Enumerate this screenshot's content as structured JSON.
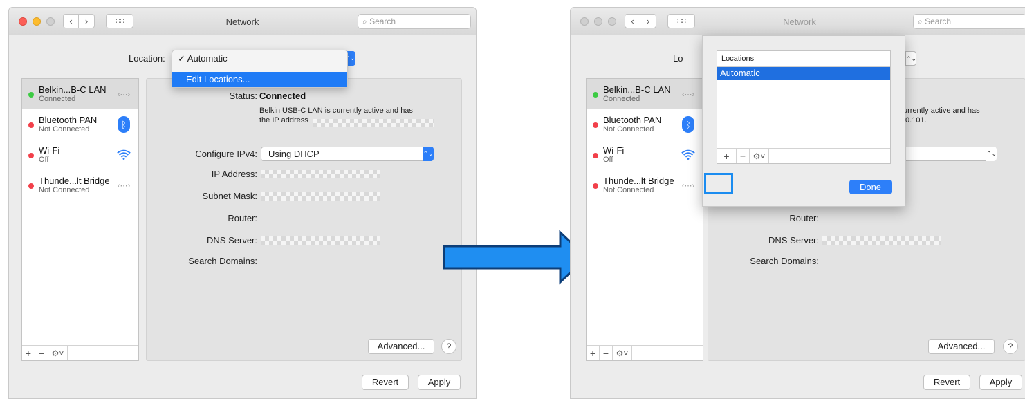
{
  "window_title": "Network",
  "search_placeholder": "Search",
  "location_label": "Location:",
  "location_label_truncated": "Lo",
  "location_menu": {
    "checked": "✓ Automatic",
    "edit": "Edit Locations..."
  },
  "services": [
    {
      "name": "Belkin...B-C LAN",
      "status": "Connected",
      "color": "#3ccb43"
    },
    {
      "name": "Bluetooth PAN",
      "status": "Not Connected",
      "color": "#f2404a"
    },
    {
      "name": "Wi-Fi",
      "status": "Off",
      "color": "#f2404a"
    },
    {
      "name": "Thunde...lt Bridge",
      "status": "Not Connected",
      "color": "#f2404a"
    }
  ],
  "detail": {
    "status_label": "Status:",
    "status_value": "Connected",
    "status_desc_line1": "Belkin USB-C LAN is currently active and has",
    "status_desc_line2": "the IP address",
    "status_desc_line1_partial": "urrently active and has",
    "status_desc_line2_partial": ".0.101.",
    "configure_label": "Configure IPv4:",
    "configure_value": "Using DHCP",
    "ip_label": "IP Address:",
    "subnet_label": "Subnet Mask:",
    "router_label": "Router:",
    "dns_label": "DNS Server:",
    "search_domains_label": "Search Domains:"
  },
  "buttons": {
    "advanced": "Advanced...",
    "help": "?",
    "revert": "Revert",
    "apply": "Apply",
    "plus": "+",
    "minus": "−",
    "gear": "⚙˅"
  },
  "sheet": {
    "header": "Locations",
    "item": "Automatic",
    "done": "Done"
  },
  "icons": {
    "nav_back": "‹",
    "nav_forward": "›",
    "grid": "∷∷",
    "search": "⌕",
    "stepper": "⌃⌄",
    "bluetooth": "ᛒ",
    "ethernet": "‹⋯›"
  },
  "accent_color": "#2d7ff9",
  "highlight_color": "#1b8cf0"
}
